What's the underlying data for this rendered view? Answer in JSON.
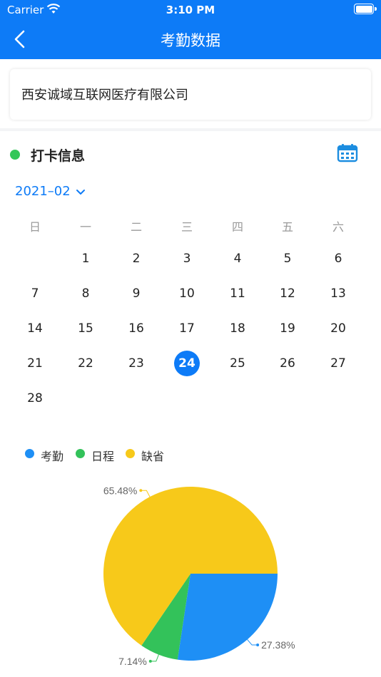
{
  "status_bar": {
    "carrier": "Carrier",
    "time": "3:10 PM"
  },
  "nav": {
    "title": "考勤数据"
  },
  "company": {
    "name": "西安诚域互联网医疗有限公司"
  },
  "section": {
    "title": "打卡信息"
  },
  "calendar": {
    "month_label": "2021–02",
    "weekdays": [
      "日",
      "一",
      "二",
      "三",
      "四",
      "五",
      "六"
    ],
    "selected_day": "24",
    "days": [
      "1",
      "2",
      "3",
      "4",
      "5",
      "6",
      "7",
      "8",
      "9",
      "10",
      "11",
      "12",
      "13",
      "14",
      "15",
      "16",
      "17",
      "18",
      "19",
      "20",
      "21",
      "22",
      "23",
      "24",
      "25",
      "26",
      "27",
      "28"
    ]
  },
  "colors": {
    "accent": "#0d7bf7",
    "attendance": "#1e8ff5",
    "schedule": "#33c25a",
    "absent": "#f7c91a"
  },
  "chart_data": {
    "type": "pie",
    "legend": [
      "考勤",
      "日程",
      "缺省"
    ],
    "values": [
      27.38,
      7.14,
      65.48
    ],
    "labels": [
      "27.38%",
      "7.14%",
      "65.48%"
    ]
  }
}
